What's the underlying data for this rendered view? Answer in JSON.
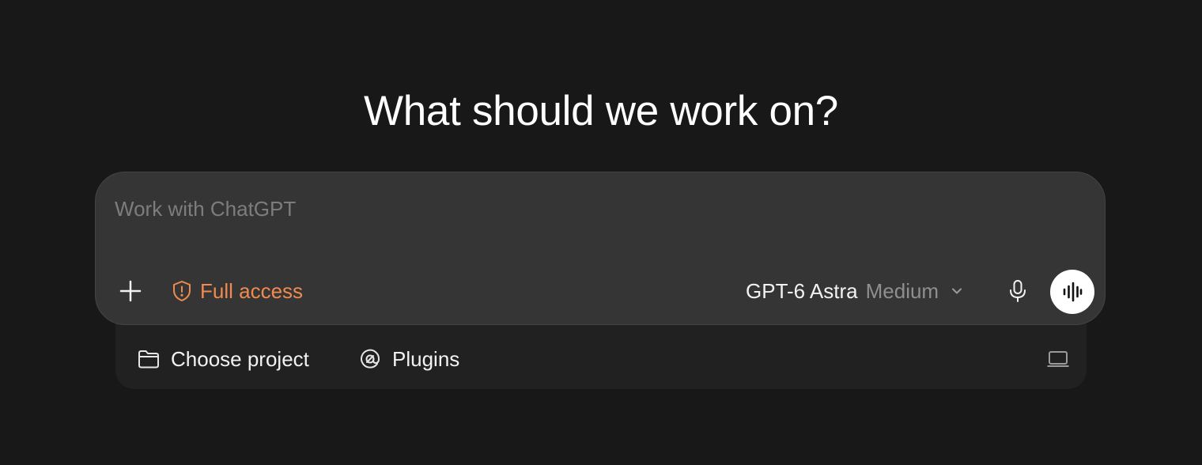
{
  "heading": "What should we work on?",
  "composer": {
    "placeholder": "Work with ChatGPT",
    "value": "",
    "access_label": "Full access",
    "model_name": "GPT-6 Astra",
    "model_variant": "Medium"
  },
  "subbar": {
    "project_label": "Choose project",
    "plugins_label": "Plugins"
  },
  "icons": {
    "add": "plus-icon",
    "access": "shield-alert-icon",
    "model_dropdown": "chevron-down-icon",
    "mic": "microphone-icon",
    "voice": "voice-waveform-icon",
    "project": "folder-icon",
    "plugins": "plugins-icon",
    "device": "laptop-icon"
  },
  "colors": {
    "background": "#181818",
    "composer": "#353535",
    "subbar": "#212121",
    "accent_warning": "#f08a4f",
    "muted_text": "#8f8f8f"
  }
}
